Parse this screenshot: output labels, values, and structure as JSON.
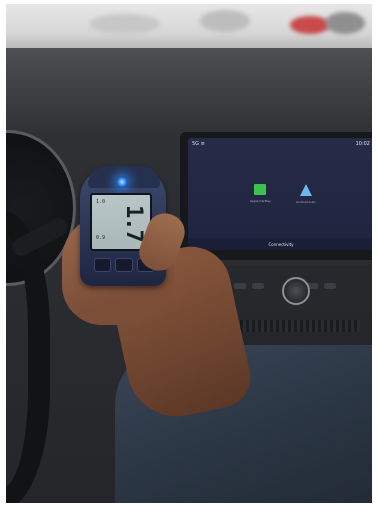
{
  "image": {
    "subject": "infrared-thermometer-in-car",
    "colors": {
      "thermometer": "#2b3555",
      "laser": "#2d8cff",
      "lcd": "#b9c6c8",
      "screen": "#262b47",
      "tile_green": "#3ec24f",
      "tile_blue": "#6fb7e8",
      "sleeve": "#2b3644",
      "skin": "#7b4e37"
    }
  },
  "thermometer": {
    "reading_big": "1.7",
    "reading_small_top": "1.0",
    "reading_small_left": "0.9"
  },
  "infotainment": {
    "status_left": "5G ≡",
    "status_right": "10:02",
    "tiles": [
      {
        "label": "Apple CarPlay",
        "icon": "carplay-icon"
      },
      {
        "label": "Android Auto",
        "icon": "android-auto-icon"
      }
    ],
    "footer": "Connectivity"
  }
}
